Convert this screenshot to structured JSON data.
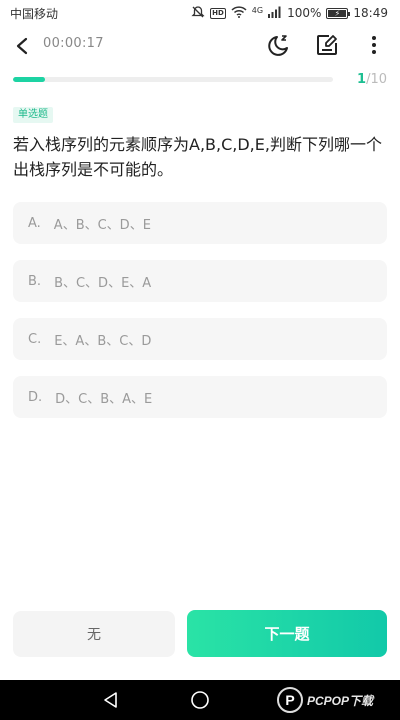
{
  "status_bar": {
    "carrier": "中国移动",
    "hd": "HD",
    "signal_label": "4G",
    "battery_text": "100%",
    "battery_level": 1.0,
    "time": "18:49"
  },
  "header": {
    "timer": "00:00:17",
    "icons": [
      "back-icon",
      "night-mode-icon",
      "answer-card-icon",
      "more-icon"
    ]
  },
  "progress": {
    "current": "1",
    "total": "/10",
    "fraction": 0.1,
    "accent": "#1dd3a3"
  },
  "question": {
    "type_tag": "单选题",
    "text": "若入栈序列的元素顺序为A,B,C,D,E,判断下列哪一个出栈序列是不可能的。",
    "options": [
      {
        "letter": "A.",
        "text": "A、B、C、D、E"
      },
      {
        "letter": "B.",
        "text": "B、C、D、E、A"
      },
      {
        "letter": "C.",
        "text": "E、A、B、C、D"
      },
      {
        "letter": "D.",
        "text": "D、C、B、A、E"
      }
    ]
  },
  "actions": {
    "left_label": "无",
    "next_label": "下一题"
  },
  "watermark": {
    "logo_letter": "P",
    "text": "PCPOP下载"
  }
}
